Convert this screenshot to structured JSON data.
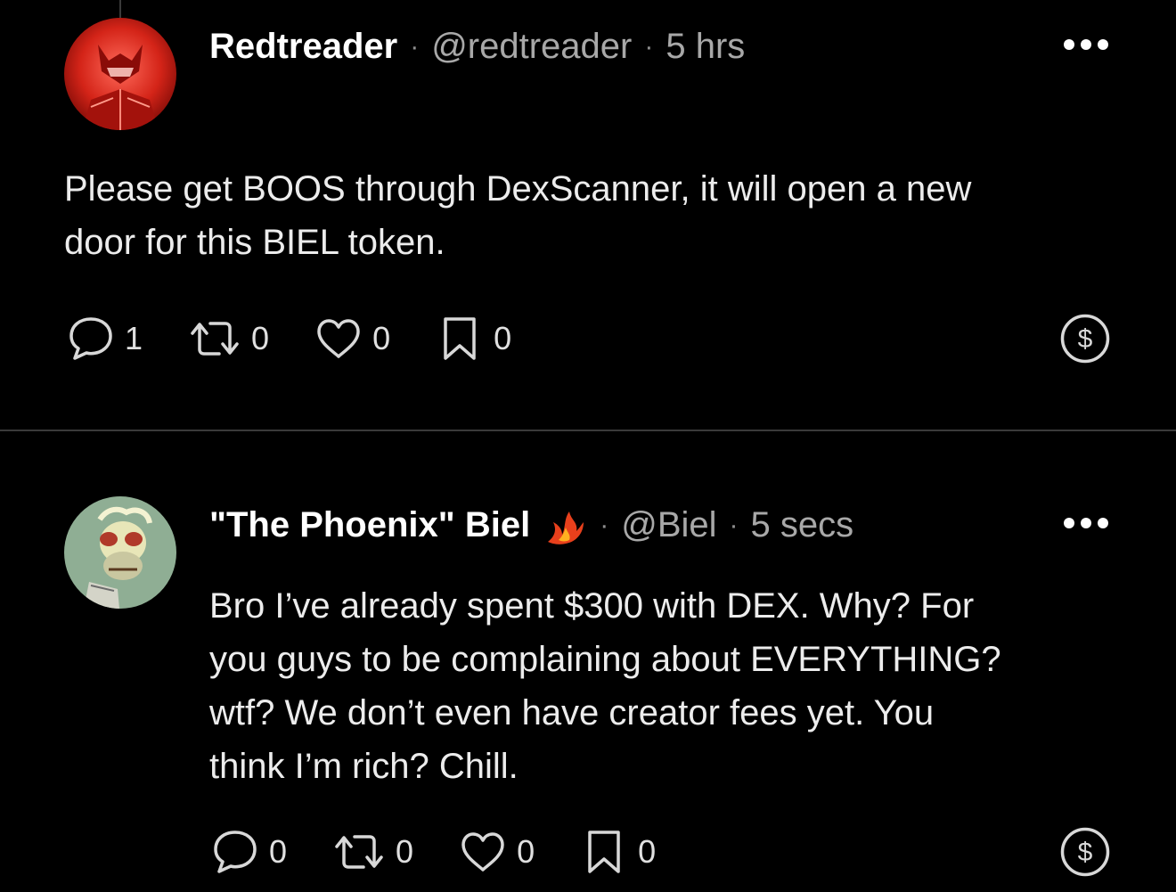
{
  "posts": [
    {
      "name": "Redtreader",
      "handle": "@redtreader",
      "separator": "·",
      "time": "5 hrs",
      "body_lines": [
        "Please get BOOS through DexScanner, it will open a new",
        "door for this BIEL token."
      ],
      "avatar_icon": "red-masked-warrior-avatar",
      "counts": {
        "replies": "1",
        "reposts": "0",
        "likes": "0",
        "bookmarks": "0"
      }
    },
    {
      "name": "\"The Phoenix\" Biel",
      "name_badge_icon": "phoenix-flame-icon",
      "handle": "@Biel",
      "separator": "·",
      "time": "5 secs",
      "body_lines": [
        "Bro I’ve already spent $300 with DEX. Why? For",
        "you guys to be complaining about EVERYTHING?",
        "wtf? We don’t even have creator fees yet. You",
        "think I’m rich? Chill."
      ],
      "avatar_icon": "ape-nft-avatar",
      "counts": {
        "replies": "0",
        "reposts": "0",
        "likes": "0",
        "bookmarks": "0"
      }
    }
  ],
  "colors": {
    "background": "#000000",
    "text": "#ececec",
    "muted": "#a8a8a8",
    "divider": "#3a3a3a"
  }
}
